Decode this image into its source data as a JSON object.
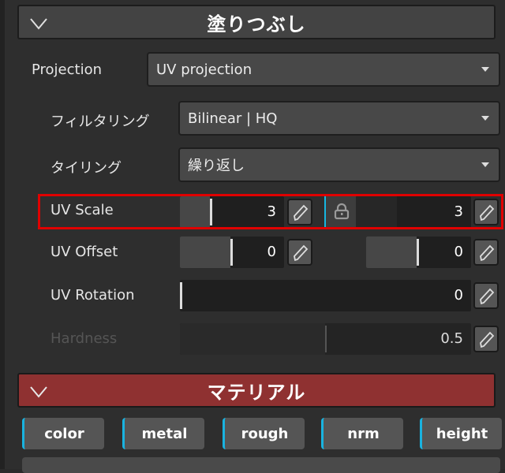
{
  "fill_panel": {
    "title": "塗りつぶし",
    "projection": {
      "label": "Projection",
      "value": "UV projection"
    },
    "filtering": {
      "label": "フィルタリング",
      "value": "Bilinear | HQ"
    },
    "tiling": {
      "label": "タイリング",
      "value": "繰り返し"
    },
    "uv_scale": {
      "label": "UV Scale",
      "x": "3",
      "y": "3",
      "locked": true
    },
    "uv_offset": {
      "label": "UV Offset",
      "x": "0",
      "y": "0"
    },
    "uv_rotation": {
      "label": "UV Rotation",
      "value": "0"
    },
    "hardness": {
      "label": "Hardness",
      "value": "0.5",
      "disabled": true
    }
  },
  "material_panel": {
    "title": "マテリアル",
    "channels": [
      "color",
      "metal",
      "rough",
      "nrm",
      "height"
    ]
  },
  "colors": {
    "accent": "#19b3e0",
    "material_header": "#8f3131",
    "highlight": "#e00000"
  },
  "icons": {
    "collapse": "chevron-down-icon",
    "edit": "pencil-icon",
    "lock": "lock-icon",
    "dropdown": "caret-down-icon"
  }
}
